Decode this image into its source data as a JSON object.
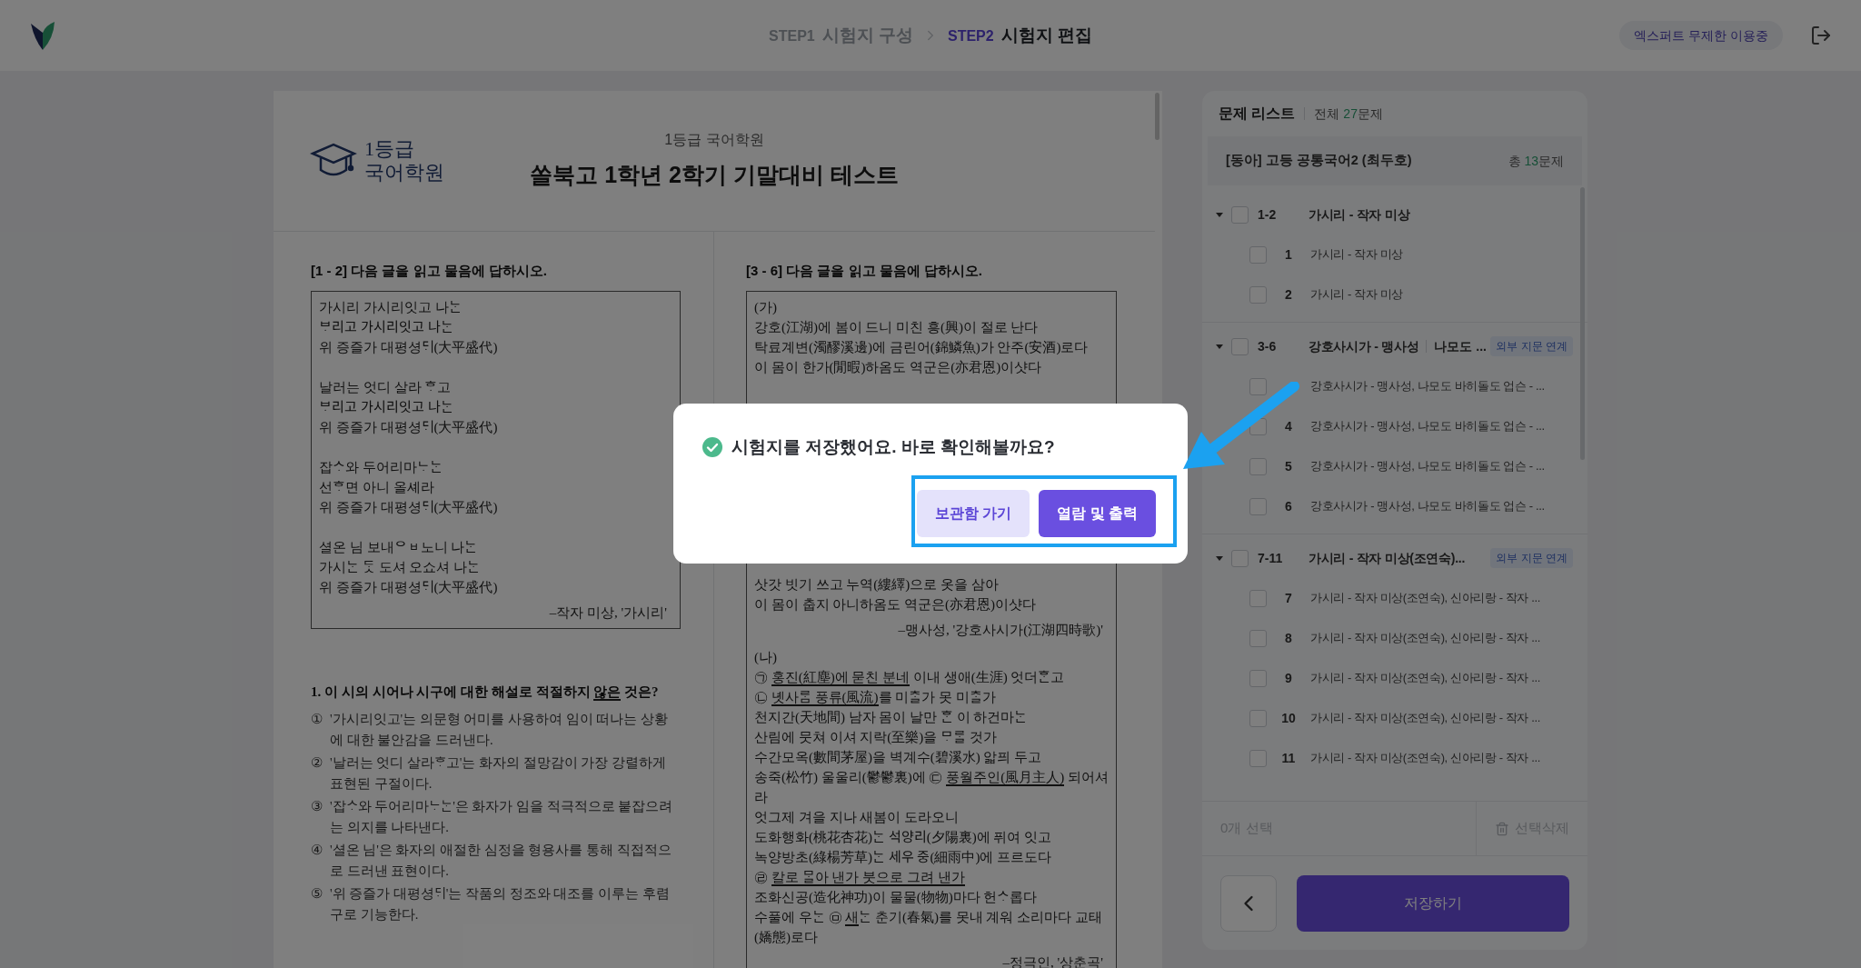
{
  "header": {
    "steps": [
      {
        "step": "STEP1",
        "title": "시험지 구성",
        "selected": false
      },
      {
        "step": "STEP2",
        "title": "시험지 편집",
        "selected": true
      }
    ],
    "plan_badge": "엑스퍼트 무제한 이용중"
  },
  "document": {
    "logo_text": [
      "1등급",
      "국어학원"
    ],
    "academy": "1등급 국어학원",
    "title": "쏠북고 1학년 2학기 기말대비 테스트",
    "sections": [
      {
        "heading": "[1 - 2] 다음 글을 읽고 물음에 답하시오.",
        "parts": [
          {
            "stanzas": [
              [
                "가시리 가시리잇고 나ᄂᆞᆫ",
                "ᄇᆞ리고 가시리잇고 나ᄂᆞᆫ",
                "위 증즐가 대평셩ᄃᆡ(大平盛代)"
              ],
              [
                "날러는 엇디 살라 ᄒᆞ고",
                "ᄇᆞ리고 가시리잇고 나ᄂᆞᆫ",
                "위 증즐가 대평셩ᄃᆡ(大平盛代)"
              ],
              [
                "잡ᄉᆞ와 두어리마ᄂᆞᄂᆞᆫ",
                "선ᄒᆞ면 아니 올셰라",
                "위 증즐가 대평셩ᄃᆡ(大平盛代)"
              ],
              [
                "셜온 님 보내ᄋᆸ노니 나ᄂᆞᆫ",
                "가시ᄂᆞᆫ ᄃᆞᆺ 도셔 오쇼셔 나ᄂᆞᆫ",
                "위 증즐가 대평셩ᄃᆡ(大平盛代)"
              ]
            ],
            "source": "–작자 미상, '가시리'"
          }
        ],
        "questions": [
          {
            "prompt": [
              {
                "text": "1. 이 시의 시어나 시구에 대한 해설로 적절하지 ",
                "underlined": false
              },
              {
                "text": "않은",
                "underlined": true
              },
              {
                "text": " 것은?",
                "underlined": false
              }
            ],
            "options": [
              {
                "marker": "①",
                "text": "'가시리잇고'는 의문형 어미를 사용하여 임이 떠나는 상황에 대한 불안감을 드러낸다."
              },
              {
                "marker": "②",
                "text": "'날러는 엇디 살라ᄒᆞ고'는 화자의 절망감이 가장 강렬하게 표현된 구절이다."
              },
              {
                "marker": "③",
                "text": "'잡ᄉᆞ와 두어리마ᄂᆞᄂᆞᆫ'은 화자가 임을 적극적으로 붙잡으려는 의지를 나타낸다."
              },
              {
                "marker": "④",
                "text": "'셜온 님'은 화자의 애절한 심정을 형용사를 통해 직접적으로 드러낸 표현이다."
              },
              {
                "marker": "⑤",
                "text": "'위 증즐가 대평셩ᄃᆡ'는 작품의 정조와 대조를 이루는 후렴구로 기능한다."
              }
            ]
          }
        ]
      },
      {
        "heading": "[3 - 6] 다음 글을 읽고 물음에 답하시오.",
        "parts": [
          {
            "label": "(가)",
            "stanzas": [
              [
                "강호(江湖)에 봄이 드니 미친 흥(興)이 절로 난다",
                "탁료계변(濁醪溪邊)에 금린어(錦鱗魚)가 안주(安酒)로다",
                "이 몸이 한가(閒暇)하옴도 역군은(亦君恩)이샷다"
              ],
              [
                "삿갓 빗기 쓰고 누역(縷繹)으로 옷을 삼아",
                "이 몸이 춥지 아니하옴도 역군은(亦君恩)이샷다"
              ]
            ],
            "source": "–맹사성, '강호사시가(江湖四時歌)'"
          },
          {
            "label": "(나)",
            "stanzas": [
              [
                [
                  {
                    "text": "㉠ ",
                    "underlined": false
                  },
                  {
                    "text": "홍진(紅塵)에 묻친 분네",
                    "underlined": true
                  },
                  {
                    "text": " 이내 생애(生涯) 엇더ᄒᆞᆫ고",
                    "underlined": false
                  }
                ],
                [
                  {
                    "text": "㉡ ",
                    "underlined": false
                  },
                  {
                    "text": "녯사ᄅᆞᆷ 풍류(風流)",
                    "underlined": true
                  },
                  {
                    "text": "를 미ᄎᆞᆯ가 못 미ᄎᆞᆯ가",
                    "underlined": false
                  }
                ],
                "천지간(天地間) 남자 몸이 날만 ᄒᆞᆫ 이 하건마ᄂᆞᆫ",
                "산림에 뭇쳐 이셔 지락(至樂)을 ᄆᆞᄅᆞᆯ 것가",
                "수간모옥(數間茅屋)을 벽계수(碧溪水) 앏픠 두고",
                [
                  {
                    "text": "송죽(松竹) 울울리(鬱鬱裏)에 ㉢ ",
                    "underlined": false
                  },
                  {
                    "text": "풍월주인(風月主人)",
                    "underlined": true
                  },
                  {
                    "text": " 되어셔",
                    "underlined": false
                  }
                ],
                "라",
                "엇그제 겨을 지나 새봄이 도라오니",
                "도화행화(桃花杏花)ᄂᆞᆫ 석양리(夕陽裏)에 퓌여 잇고",
                "녹양방초(綠楊芳草)ᄂᆞᆫ 세우 중(細雨中)에 프르도다",
                [
                  {
                    "text": "㉣ ",
                    "underlined": false
                  },
                  {
                    "text": "칼로 ᄆᆞᆯ아 낸가 붓으로 그려 낸가",
                    "underlined": true
                  }
                ],
                "조화신공(造化神功)이 물물(物物)마다 헌ᄉᆞ롭다",
                [
                  {
                    "text": "수풀에 우ᄂᆞᆫ ㉤ ",
                    "underlined": false
                  },
                  {
                    "text": "새",
                    "underlined": true
                  },
                  {
                    "text": "ᄂᆞᆫ 춘기(春氣)를 못내 계워 소리마다 교태",
                    "underlined": false
                  }
                ],
                "(嬌態)로다"
              ]
            ],
            "source": "–정극인, '상춘곡'"
          }
        ]
      }
    ]
  },
  "problem_list": {
    "title": "문제 리스트",
    "total": {
      "label": "전체 ",
      "count": "27",
      "unit": "문제"
    },
    "book": {
      "name": "[동아] 고등 공통국어2 (최두호)",
      "total": {
        "label": "총 ",
        "count": "13",
        "unit": "문제"
      }
    },
    "groups": [
      {
        "range": "1-2",
        "title": "가시리 - 작자 미상",
        "expanded": true,
        "checked": false,
        "children": [
          {
            "number": "1",
            "title": "가시리 - 작자 미상",
            "checked": false
          },
          {
            "number": "2",
            "title": "가시리 - 작자 미상",
            "checked": false
          }
        ]
      },
      {
        "range": "3-6",
        "title": "강호사시가 - 맹사성",
        "subtitle": "나모도 ...",
        "tag": "외부 지문 연계",
        "expanded": true,
        "checked": false,
        "children": [
          {
            "title": "강호사시가 - 맹사성, 나모도 바히돌도 업슨 - ...",
            "checked": false
          },
          {
            "number": "4",
            "title": "강호사시가 - 맹사성, 나모도 바히돌도 업슨 - ...",
            "checked": false
          },
          {
            "number": "5",
            "title": "강호사시가 - 맹사성, 나모도 바히돌도 업슨 - ...",
            "checked": false
          },
          {
            "number": "6",
            "title": "강호사시가 - 맹사성, 나모도 바히돌도 업슨 - ...",
            "checked": false
          }
        ]
      },
      {
        "range": "7-11",
        "title": "가시리 - 작자 미상(조연숙)...",
        "tag": "외부 지문 연계",
        "expanded": true,
        "checked": false,
        "children": [
          {
            "number": "7",
            "title": "가시리 - 작자 미상(조연숙), 신아리랑 - 작자 ...",
            "checked": false
          },
          {
            "number": "8",
            "title": "가시리 - 작자 미상(조연숙), 신아리랑 - 작자 ...",
            "checked": false
          },
          {
            "number": "9",
            "title": "가시리 - 작자 미상(조연숙), 신아리랑 - 작자 ...",
            "checked": false
          },
          {
            "number": "10",
            "title": "가시리 - 작자 미상(조연숙), 신아리랑 - 작자 ...",
            "checked": false
          },
          {
            "number": "11",
            "title": "가시리 - 작자 미상(조연숙), 신아리랑 - 작자 ...",
            "checked": false
          }
        ]
      }
    ],
    "selection_count": "0개 선택",
    "delete_button": "선택삭제",
    "save_button": "저장하기"
  },
  "modal": {
    "message": "시험지를 저장했어요. 바로 확인해볼까요?",
    "buttons": [
      {
        "label": "보관함 가기",
        "kind": "secondary"
      },
      {
        "label": "열람 및 출력",
        "kind": "primary"
      }
    ]
  }
}
